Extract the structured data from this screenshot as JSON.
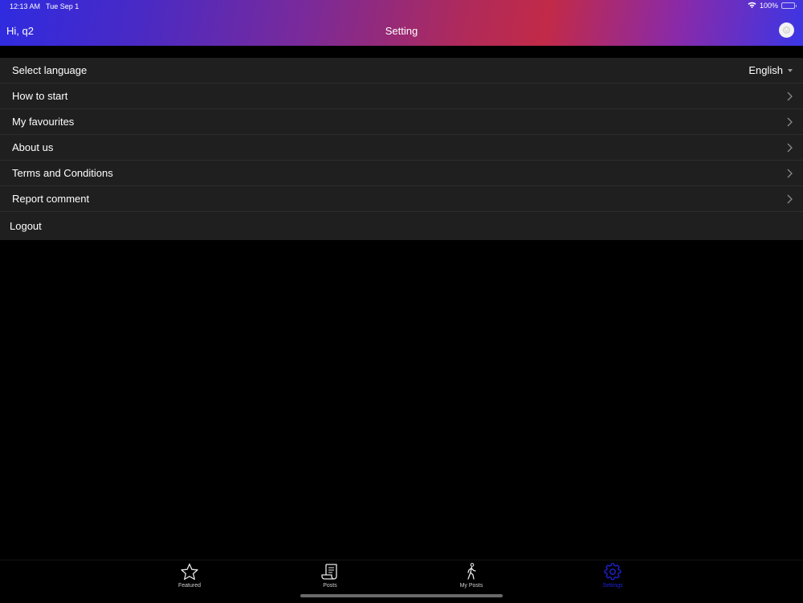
{
  "status_bar": {
    "time": "12:13 AM",
    "date": "Tue Sep 1",
    "battery_percent": "100%",
    "battery_level": 1.0
  },
  "header": {
    "greeting": "Hi, q2",
    "title": "Setting",
    "gradient_colors": [
      "#2f2be0",
      "#c22a48",
      "#3b36e6"
    ]
  },
  "settings": {
    "language": {
      "label": "Select language",
      "value": "English"
    },
    "items": [
      {
        "label": "How to start"
      },
      {
        "label": "My favourites"
      },
      {
        "label": "About us"
      },
      {
        "label": "Terms and Conditions"
      },
      {
        "label": "Report comment"
      }
    ],
    "logout_label": "Logout"
  },
  "tabs": [
    {
      "label": "Featured",
      "icon": "star-icon",
      "active": false
    },
    {
      "label": "Posts",
      "icon": "scroll-icon",
      "active": false
    },
    {
      "label": "My Posts",
      "icon": "walking-person-icon",
      "active": false
    },
    {
      "label": "Settings",
      "icon": "gear-icon",
      "active": true
    }
  ],
  "colors": {
    "row_background": "#1f1f1f",
    "active_tab": "#1e22d8",
    "inactive_tab": "#cfcfcf"
  }
}
